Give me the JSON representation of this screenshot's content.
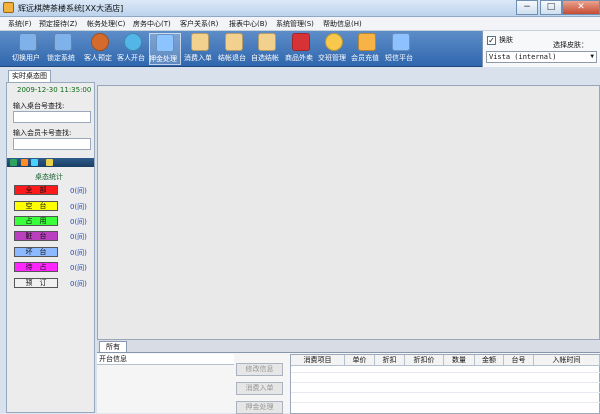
{
  "window": {
    "title": "辉远棋牌茶楼系统[XX大酒店]",
    "controls": [
      "−",
      "□",
      "✕"
    ]
  },
  "menu": [
    "系统(F)",
    "预定接待(Z)",
    "帐务处理(C)",
    "房务中心(T)",
    "客户关系(R)",
    "报表中心(B)",
    "系统管理(S)",
    "帮助信息(H)"
  ],
  "toolbar": [
    {
      "label": "切换用户",
      "icon": "monitor-icon",
      "color": "#7fb1ea"
    },
    {
      "label": "锁定系统",
      "icon": "monitor-lock-icon",
      "color": "#7fb1ea"
    },
    {
      "label": "客人预定",
      "icon": "gear-icon",
      "color": "#d46b2c"
    },
    {
      "label": "客人开台",
      "icon": "person-add-icon",
      "color": "#52b7e8"
    },
    {
      "label": "押金处理",
      "icon": "person-money-icon",
      "color": "#8bc4ff"
    },
    {
      "label": "消费入单",
      "icon": "clipboard-icon",
      "color": "#f2d08d"
    },
    {
      "label": "结帐退台",
      "icon": "clipboard-check-icon",
      "color": "#f2d08d"
    },
    {
      "label": "自选结帐",
      "icon": "clipboard-list-icon",
      "color": "#f2d08d"
    },
    {
      "label": "商品外卖",
      "icon": "bag-icon",
      "color": "#d73337"
    },
    {
      "label": "交班管理",
      "icon": "person-exchange-icon",
      "color": "#f7c84b"
    },
    {
      "label": "会员充值",
      "icon": "card-icon",
      "color": "#f7b345"
    },
    {
      "label": "短信平台",
      "icon": "phone-icon",
      "color": "#8ec1ff"
    }
  ],
  "skin": {
    "checkbox_label": "换肤",
    "checked": "✓",
    "label": "选择皮肤：",
    "selected": "Vista (internal)"
  },
  "tab": "实时桌态图",
  "left_panel": {
    "datetime": "2009-12-30 11:35:00",
    "table_search_label": "输入桌台号查找:",
    "member_search_label": "输入会员卡号查找:",
    "stats_title": "桌态统计",
    "statuses": [
      {
        "label": "全　部",
        "count": "0(间)",
        "color": "#ff1b1b"
      },
      {
        "label": "空　台",
        "count": "0(间)",
        "color": "#ffff00"
      },
      {
        "label": "占　用",
        "count": "0(间)",
        "color": "#3cff3c"
      },
      {
        "label": "脏　台",
        "count": "0(间)",
        "color": "#bb40bf"
      },
      {
        "label": "坏　台",
        "count": "0(间)",
        "color": "#8db9ff"
      },
      {
        "label": "待　占",
        "count": "0(间)",
        "color": "#ff26ff"
      },
      {
        "label": "预　订",
        "count": "0(间)",
        "color": "#f1f1f1"
      }
    ]
  },
  "bottom": {
    "tab": "所有",
    "opening_info": "开台信息",
    "buttons": [
      "修改信息",
      "消费入单",
      "押金处理"
    ],
    "columns": [
      "消费项目",
      "单价",
      "折扣",
      "折扣价",
      "数量",
      "金额",
      "台号",
      "入帐时间"
    ]
  }
}
